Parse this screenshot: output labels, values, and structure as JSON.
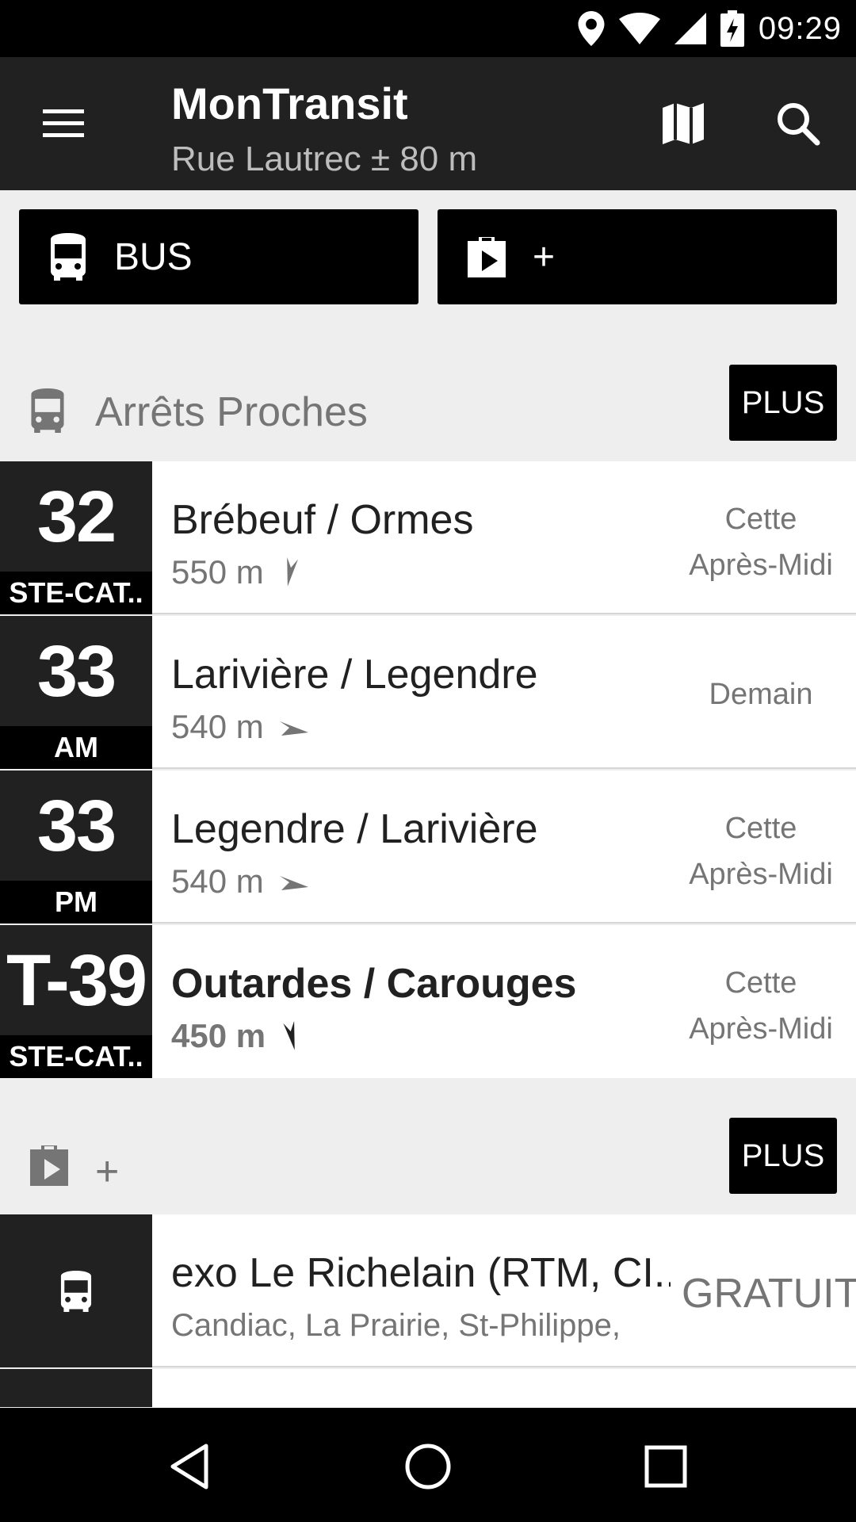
{
  "status_bar": {
    "time": "09:29",
    "icons": [
      "location-icon",
      "wifi-icon",
      "signal-icon",
      "battery-icon"
    ]
  },
  "app_bar": {
    "title": "MonTransit",
    "subtitle": "Rue Lautrec ± 80 m"
  },
  "quick_buttons": [
    {
      "label": "BUS",
      "icon": "bus-icon"
    },
    {
      "label": "+",
      "icon": "play-bag-icon"
    }
  ],
  "nearby": {
    "title": "Arrêts Proches",
    "more_label": "PLUS",
    "stops": [
      {
        "route": "32",
        "direction": "STE-CAT..",
        "name": "Brébeuf / Ormes",
        "distance": "550 m",
        "time": "Cette\nAprès-Midi",
        "bold": false
      },
      {
        "route": "33",
        "direction": "AM",
        "name": "Larivière / Legendre",
        "distance": "540 m",
        "time": "Demain",
        "bold": false
      },
      {
        "route": "33",
        "direction": "PM",
        "name": "Legendre / Larivière",
        "distance": "540 m",
        "time": "Cette\nAprès-Midi",
        "bold": false
      },
      {
        "route": "T-39",
        "direction": "STE-CAT..",
        "name": "Outardes / Carouges",
        "distance": "450 m",
        "time": "Cette\nAprès-Midi",
        "bold": true
      }
    ]
  },
  "modules": {
    "title": "+",
    "more_label": "PLUS",
    "agency": {
      "name": "exo Le Richelain (RTM, CI..",
      "location": "Candiac, La Prairie, St-Philippe,",
      "price": "GRATUIT"
    }
  },
  "colors": {
    "app_bar": "#212121",
    "route_box": "#212121",
    "background": "#eeeeee",
    "accent": "#000000"
  }
}
